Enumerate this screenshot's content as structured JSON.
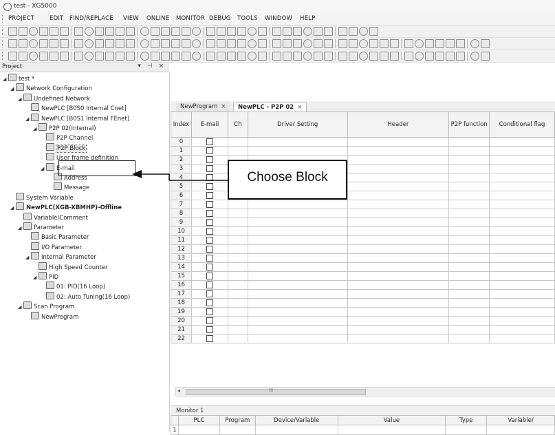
{
  "window": {
    "title": "test - XG5000"
  },
  "menu": [
    "PROJECT",
    "EDIT",
    "FIND/REPLACE",
    "VIEW",
    "ONLINE",
    "MONITOR",
    "DEBUG",
    "TOOLS",
    "WINDOW",
    "HELP"
  ],
  "project_pane": {
    "title": "Project",
    "controls": "▾ ⊣ ×",
    "tree": [
      {
        "label": "test *",
        "level": 0,
        "expand": "◢",
        "icon": "project-icon"
      },
      {
        "label": "Network Configuration",
        "level": 1,
        "expand": "◢",
        "icon": "network-icon"
      },
      {
        "label": "Undefined Network",
        "level": 2,
        "expand": "◢",
        "icon": "network-icon"
      },
      {
        "label": "NewPLC [B0S0 Internal Cnet]",
        "level": 3,
        "expand": "",
        "icon": "plc-icon"
      },
      {
        "label": "NewPLC [B0S1 Internal FEnet]",
        "level": 3,
        "expand": "◢",
        "icon": "plc-icon"
      },
      {
        "label": "P2P 02(Internal)",
        "level": 4,
        "expand": "◢",
        "icon": "p2p-icon"
      },
      {
        "label": "P2P Channel",
        "level": 5,
        "expand": "",
        "icon": "channel-icon"
      },
      {
        "label": "P2P Block",
        "level": 5,
        "expand": "",
        "icon": "block-icon",
        "selected": true
      },
      {
        "label": "User frame definition",
        "level": 5,
        "expand": "",
        "icon": "frame-icon"
      },
      {
        "label": "E-mail",
        "level": 5,
        "expand": "◢",
        "icon": "email-icon"
      },
      {
        "label": "Address",
        "level": 6,
        "expand": "",
        "icon": "address-icon"
      },
      {
        "label": "Message",
        "level": 6,
        "expand": "",
        "icon": "message-icon"
      },
      {
        "label": "System Variable",
        "level": 1,
        "expand": "",
        "icon": "variable-icon"
      },
      {
        "label": "NewPLC(XGB-XBMHP)-Offline",
        "level": 1,
        "expand": "◢",
        "icon": "plc-icon",
        "bold": true
      },
      {
        "label": "Variable/Comment",
        "level": 2,
        "expand": "",
        "icon": "variable-icon"
      },
      {
        "label": "Parameter",
        "level": 2,
        "expand": "◢",
        "icon": "parameter-icon"
      },
      {
        "label": "Basic Parameter",
        "level": 3,
        "expand": "",
        "icon": "parameter-icon"
      },
      {
        "label": "I/O Parameter",
        "level": 3,
        "expand": "",
        "icon": "parameter-icon"
      },
      {
        "label": "Internal Parameter",
        "level": 3,
        "expand": "◢",
        "icon": "parameter-icon"
      },
      {
        "label": "High Speed Counter",
        "level": 4,
        "expand": "",
        "icon": "parameter-icon"
      },
      {
        "label": "PID",
        "level": 4,
        "expand": "◢",
        "icon": "parameter-icon"
      },
      {
        "label": "01: PID(16 Loop)",
        "level": 5,
        "expand": "",
        "icon": "parameter-icon"
      },
      {
        "label": "02: Auto Tuning(16 Loop)",
        "level": 5,
        "expand": "",
        "icon": "parameter-icon"
      },
      {
        "label": "Scan Program",
        "level": 2,
        "expand": "◢",
        "icon": "scan-icon"
      },
      {
        "label": "NewProgram",
        "level": 3,
        "expand": "",
        "icon": "program-icon"
      }
    ]
  },
  "tabs": [
    {
      "label": "NewProgram",
      "close": "×",
      "active": false
    },
    {
      "label": "NewPLC - P2P 02",
      "close": "×",
      "active": true
    }
  ],
  "table": {
    "headers": [
      "Index",
      "E-mail",
      "Ch",
      "Driver Setting",
      "Header",
      "P2P function",
      "Conditional flag"
    ],
    "rows": [
      "0",
      "1",
      "2",
      "3",
      "4",
      "5",
      "6",
      "7",
      "8",
      "9",
      "10",
      "11",
      "12",
      "13",
      "14",
      "15",
      "16",
      "17",
      "18",
      "19",
      "20",
      "21",
      "22"
    ]
  },
  "hscroll": {
    "left": "◂",
    "grip": "III"
  },
  "callout": {
    "text": "Choose Block"
  },
  "monitor": {
    "title": "Monitor 1",
    "headers": [
      "",
      "PLC",
      "Program",
      "Device/Variable",
      "Value",
      "Type",
      "Variable/"
    ],
    "rows": [
      "1"
    ]
  }
}
